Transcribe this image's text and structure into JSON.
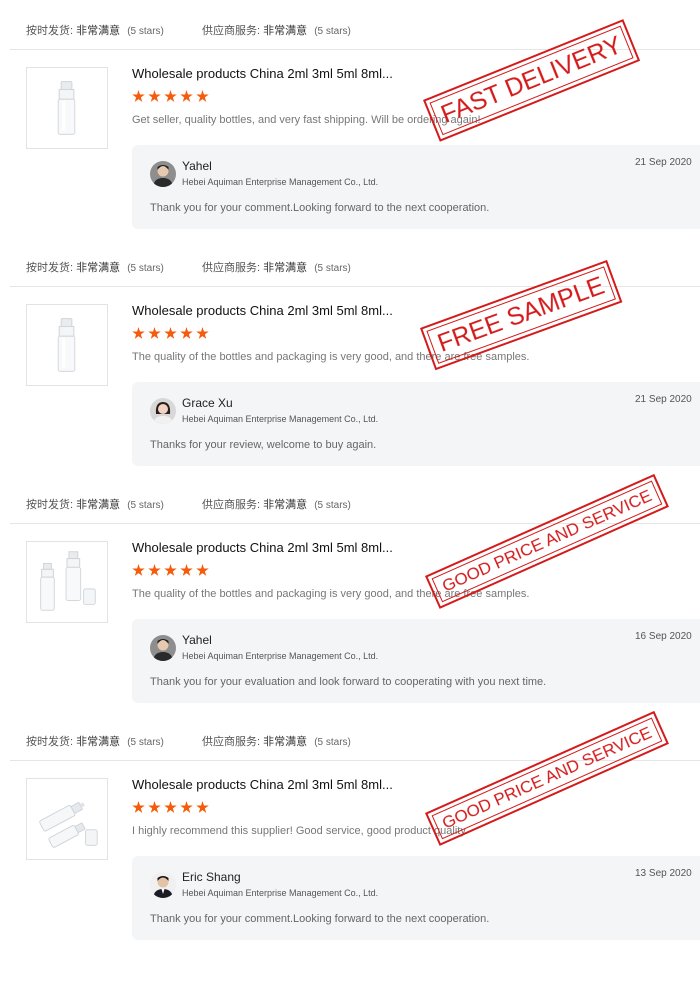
{
  "colors": {
    "star": "#f55b0b",
    "stamp": "#d41a1a",
    "reply_bg": "#f4f5f7"
  },
  "labels": {
    "on_time_delivery": "按时发货:",
    "supplier_service": "供应商服务:",
    "very_satisfied": "非常满意",
    "five_stars": "(5 stars)"
  },
  "reviews": [
    {
      "product_title": "Wholesale products China  2ml 3ml 5ml 8ml...",
      "rating": 5,
      "comment": "Get seller, quality bottles, and very fast shipping. Will be ordering again!",
      "thumb_icon": "spray-bottle-icon",
      "stamp": "FAST DELIVERY",
      "reply": {
        "name": "Yahel",
        "avatar": "man-avatar",
        "company": "Hebei Aquiman Enterprise Management Co., Ltd.",
        "date": "21 Sep 2020",
        "text": "Thank you for your comment.Looking forward to the next cooperation."
      }
    },
    {
      "product_title": "Wholesale products China  2ml 3ml 5ml 8ml...",
      "rating": 5,
      "comment": "The quality of the bottles and packaging is very good, and there are free samples.",
      "thumb_icon": "spray-bottle-icon",
      "stamp": "FREE SAMPLE",
      "reply": {
        "name": "Grace Xu",
        "avatar": "woman-avatar",
        "company": "Hebei Aquiman Enterprise Management Co., Ltd.",
        "date": "21 Sep 2020",
        "text": "Thanks for your review, welcome to buy again."
      }
    },
    {
      "product_title": "Wholesale products China  2ml 3ml 5ml 8ml...",
      "rating": 5,
      "comment": "The quality of the bottles and packaging is very good, and there are free samples.",
      "thumb_icon": "two-spray-bottles-icon",
      "stamp": "GOOD PRICE AND SERVICE",
      "reply": {
        "name": "Yahel",
        "avatar": "man-avatar",
        "company": "Hebei Aquiman Enterprise Management Co., Ltd.",
        "date": "16 Sep 2020",
        "text": "Thank you for your evaluation and look forward to cooperating with you next time."
      }
    },
    {
      "product_title": "Wholesale products China  2ml 3ml 5ml 8ml...",
      "rating": 5,
      "comment": "I highly recommend this supplier! Good service, good product quality.",
      "thumb_icon": "lying-spray-bottles-icon",
      "stamp": "GOOD PRICE AND SERVICE",
      "reply": {
        "name": "Eric Shang",
        "avatar": "man-suit-avatar",
        "company": "Hebei Aquiman Enterprise Management Co., Ltd.",
        "date": "13 Sep 2020",
        "text": "Thank you for your comment.Looking forward to the next cooperation."
      }
    }
  ]
}
